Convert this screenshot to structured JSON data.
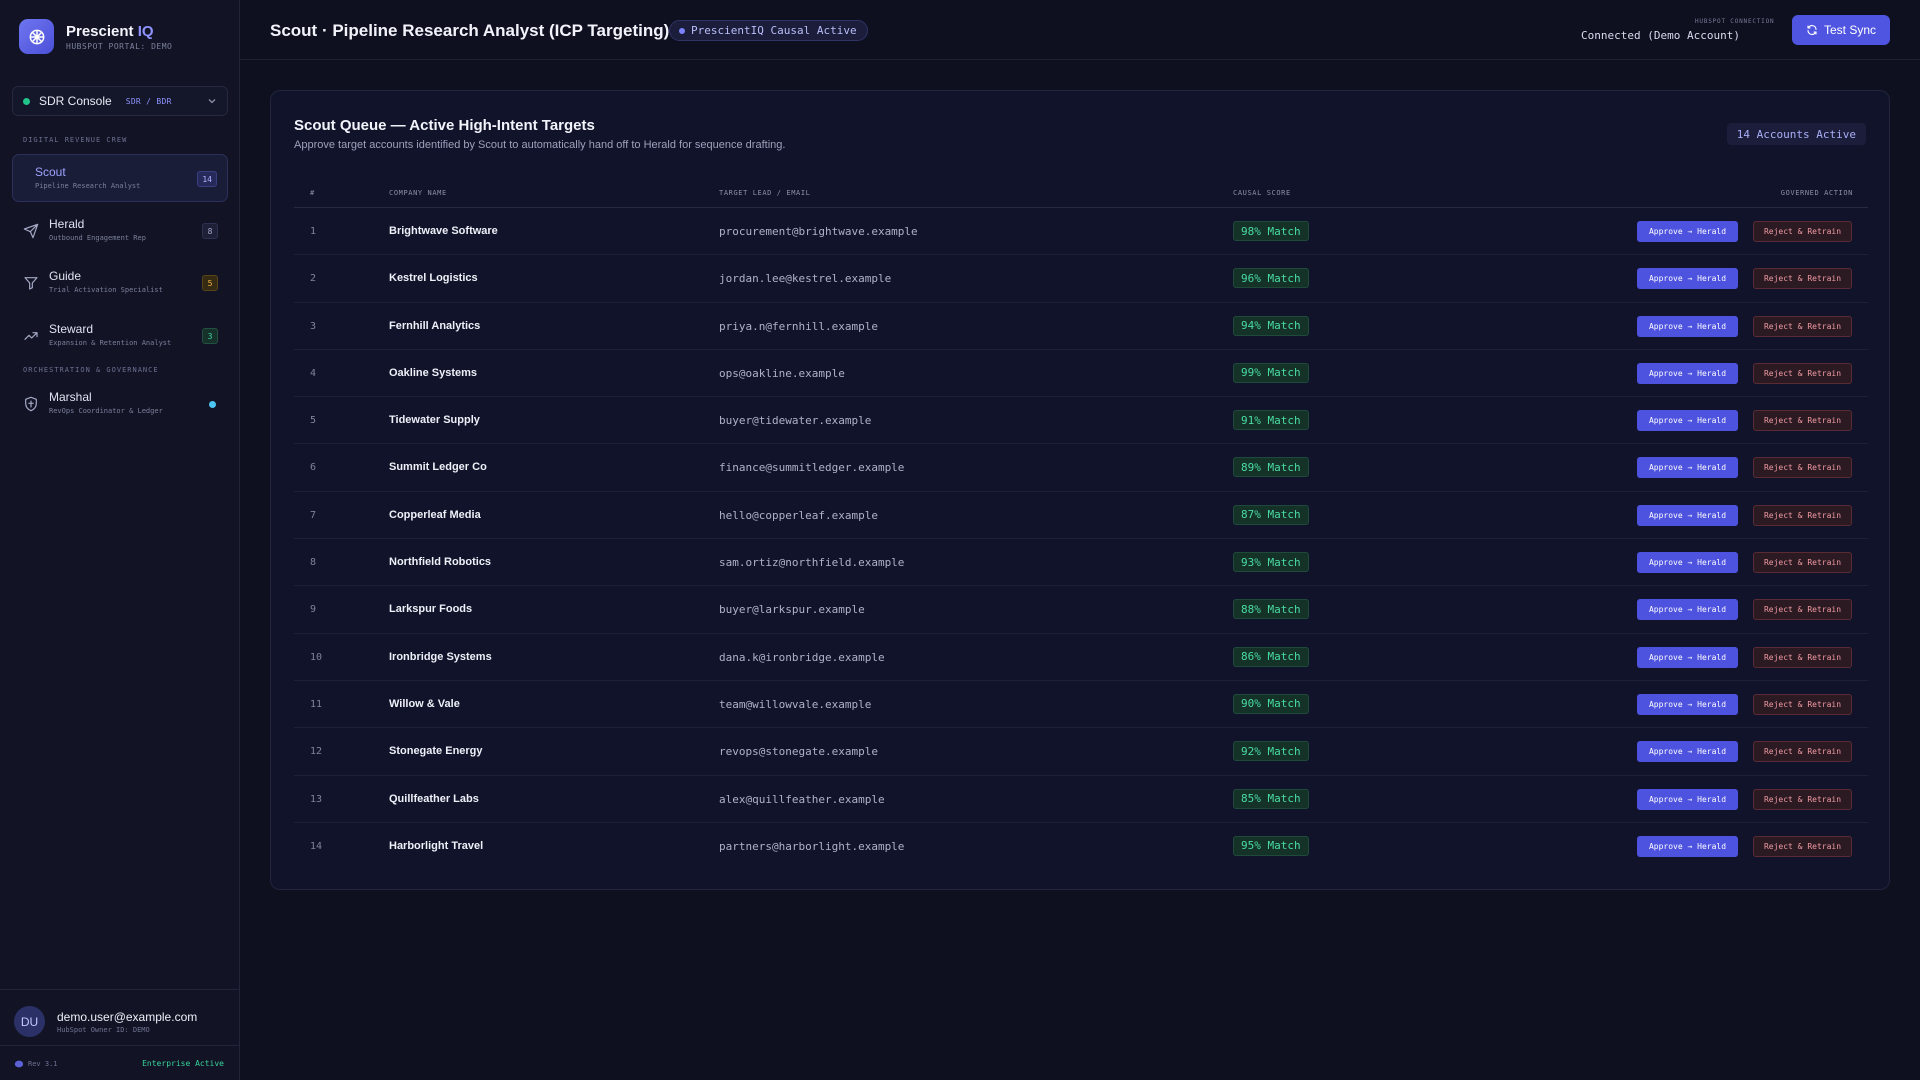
{
  "brand": {
    "name_prefix": "Prescient",
    "name_suffix": "IQ",
    "subtitle": "HUBSPOT PORTAL: DEMO"
  },
  "console": {
    "label": "SDR Console",
    "role": "SDR / BDR"
  },
  "sidebar": {
    "section_crew": "DIGITAL REVENUE CREW",
    "section_orch": "ORCHESTRATION & GOVERNANCE",
    "items": [
      {
        "title": "Scout",
        "subtitle": "Pipeline Research Analyst",
        "badge": "14",
        "icon": "search-icon"
      },
      {
        "title": "Herald",
        "subtitle": "Outbound Engagement Rep",
        "badge": "8",
        "icon": "send-icon"
      },
      {
        "title": "Guide",
        "subtitle": "Trial Activation Specialist",
        "badge": "5",
        "icon": "filter-icon"
      },
      {
        "title": "Steward",
        "subtitle": "Expansion & Retention Analyst",
        "badge": "3",
        "icon": "trending-up-icon"
      },
      {
        "title": "Marshal",
        "subtitle": "RevOps Coordinator & Ledger",
        "icon": "shield-icon"
      }
    ]
  },
  "user": {
    "initials": "DU",
    "email": "demo.user@example.com",
    "owner": "HubSpot Owner ID: DEMO"
  },
  "footer": {
    "rev": "Rev 3.1",
    "status": "Enterprise Active"
  },
  "header": {
    "title": "Scout · Pipeline Research Analyst (ICP Targeting)",
    "pill": "PrescientIQ Causal Active",
    "hubspot_label": "HUBSPOT CONNECTION",
    "hubspot_status": "Connected (Demo Account)",
    "sync_label": "Test Sync"
  },
  "queue": {
    "title": "Scout Queue — Active High-Intent Targets",
    "subtitle": "Approve target accounts identified by Scout to automatically hand off to Herald for sequence drafting.",
    "badge": "14 Accounts Active",
    "columns": [
      "#",
      "COMPANY NAME",
      "TARGET LEAD / EMAIL",
      "CAUSAL SCORE",
      "GOVERNED ACTION"
    ],
    "approve_label": "Approve → Herald",
    "reject_label": "Reject & Retrain",
    "rows": [
      {
        "n": "1",
        "company": "Brightwave Software",
        "email": "procurement@brightwave.example",
        "score": "98% Match"
      },
      {
        "n": "2",
        "company": "Kestrel Logistics",
        "email": "jordan.lee@kestrel.example",
        "score": "96% Match"
      },
      {
        "n": "3",
        "company": "Fernhill Analytics",
        "email": "priya.n@fernhill.example",
        "score": "94% Match"
      },
      {
        "n": "4",
        "company": "Oakline Systems",
        "email": "ops@oakline.example",
        "score": "99% Match"
      },
      {
        "n": "5",
        "company": "Tidewater Supply",
        "email": "buyer@tidewater.example",
        "score": "91% Match"
      },
      {
        "n": "6",
        "company": "Summit Ledger Co",
        "email": "finance@summitledger.example",
        "score": "89% Match"
      },
      {
        "n": "7",
        "company": "Copperleaf Media",
        "email": "hello@copperleaf.example",
        "score": "87% Match"
      },
      {
        "n": "8",
        "company": "Northfield Robotics",
        "email": "sam.ortiz@northfield.example",
        "score": "93% Match"
      },
      {
        "n": "9",
        "company": "Larkspur Foods",
        "email": "buyer@larkspur.example",
        "score": "88% Match"
      },
      {
        "n": "10",
        "company": "Ironbridge Systems",
        "email": "dana.k@ironbridge.example",
        "score": "86% Match"
      },
      {
        "n": "11",
        "company": "Willow & Vale",
        "email": "team@willowvale.example",
        "score": "90% Match"
      },
      {
        "n": "12",
        "company": "Stonegate Energy",
        "email": "revops@stonegate.example",
        "score": "92% Match"
      },
      {
        "n": "13",
        "company": "Quillfeather Labs",
        "email": "alex@quillfeather.example",
        "score": "85% Match"
      },
      {
        "n": "14",
        "company": "Harborlight Travel",
        "email": "partners@harborlight.example",
        "score": "95% Match"
      }
    ]
  }
}
